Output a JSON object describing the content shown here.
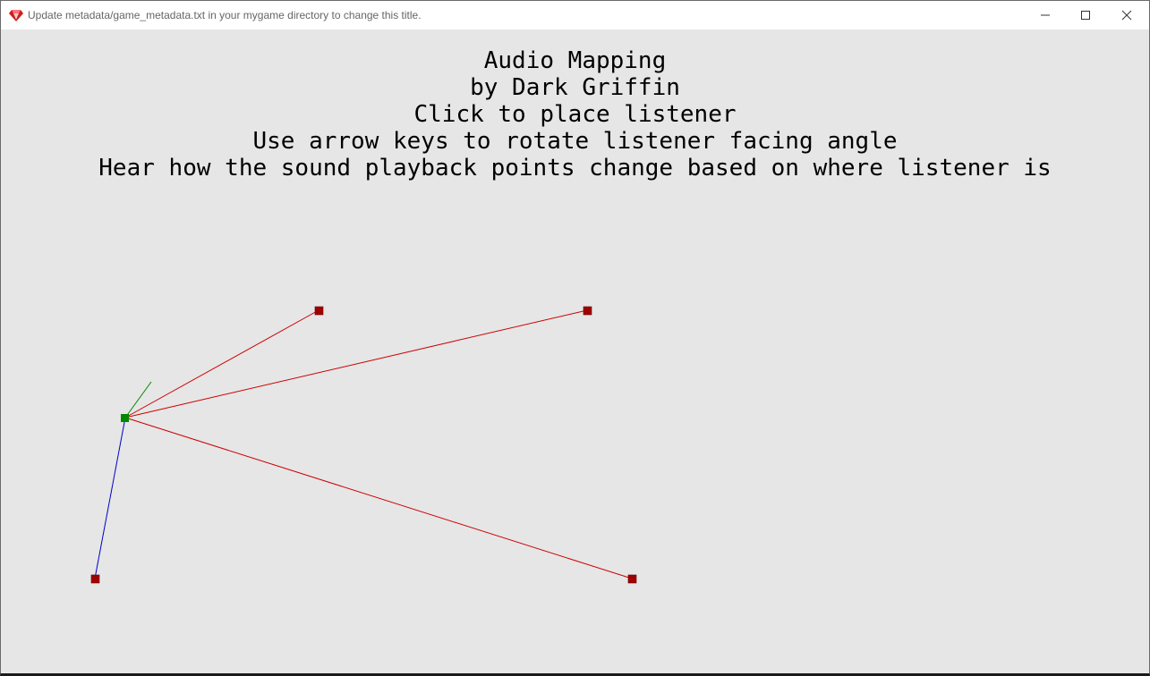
{
  "window": {
    "title": "Update metadata/game_metadata.txt in your mygame directory to change this title.",
    "icon": "ruby-gem-icon",
    "controls": [
      "minimize-icon",
      "maximize-icon",
      "close-icon"
    ]
  },
  "game": {
    "lines": [
      "Audio Mapping",
      "by Dark Griffin",
      "Click to place listener",
      "Use arrow keys to rotate listener facing angle",
      "Hear how the sound playback points change based on where listener is"
    ],
    "colors": {
      "background": "#e6e6e6",
      "sound_point": "#a00000",
      "listener": "#008800",
      "facing_line": "#008800",
      "link_line_red": "#cc0000",
      "link_line_blue": "#0000cc"
    }
  }
}
